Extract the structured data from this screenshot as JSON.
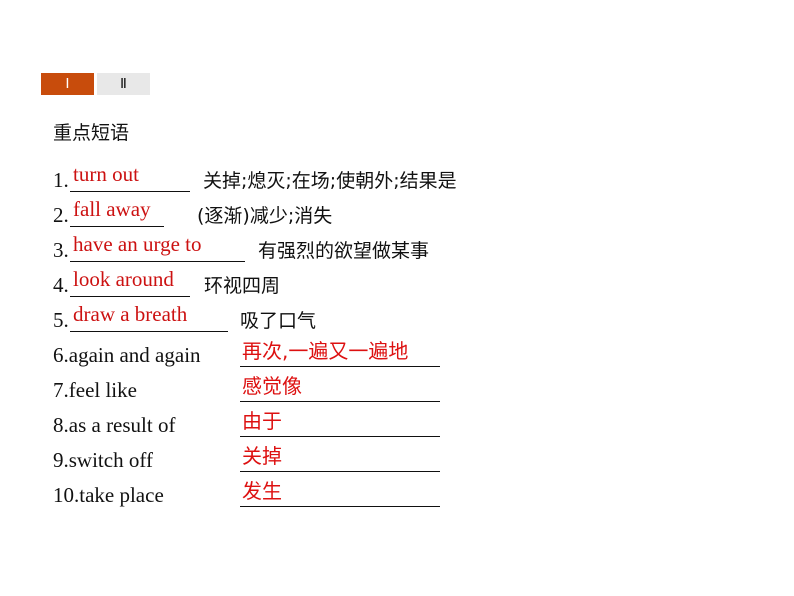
{
  "tabs": [
    {
      "label": "Ⅰ",
      "active": true
    },
    {
      "label": "Ⅱ",
      "active": false
    }
  ],
  "section_title": "重点短语",
  "fill_english": [
    {
      "number": "1.",
      "answer": "turn out",
      "meaning": "关掉;熄灭;在场;使朝外;结果是"
    },
    {
      "number": "2.",
      "answer": "fall away",
      "meaning": "(逐渐)减少;消失"
    },
    {
      "number": "3.",
      "answer": "have an urge to",
      "meaning": "有强烈的欲望做某事"
    },
    {
      "number": "4.",
      "answer": "look around",
      "meaning": "环视四周"
    },
    {
      "number": "5.",
      "answer": "draw a breath",
      "meaning": "吸了口气"
    }
  ],
  "fill_chinese": [
    {
      "number": "6.",
      "phrase": "again and again",
      "answer": "再次,一遍又一遍地"
    },
    {
      "number": "7.",
      "phrase": "feel like",
      "answer": "感觉像"
    },
    {
      "number": "8.",
      "phrase": "as a result of",
      "answer": "由于"
    },
    {
      "number": "9.",
      "phrase": "switch off",
      "answer": "关掉"
    },
    {
      "number": "10.",
      "phrase": "take place",
      "answer": "发生"
    }
  ],
  "colors": {
    "active_tab": "#c84c0c",
    "inactive_tab": "#e8e8e8",
    "answer_red": "#cc1111"
  }
}
